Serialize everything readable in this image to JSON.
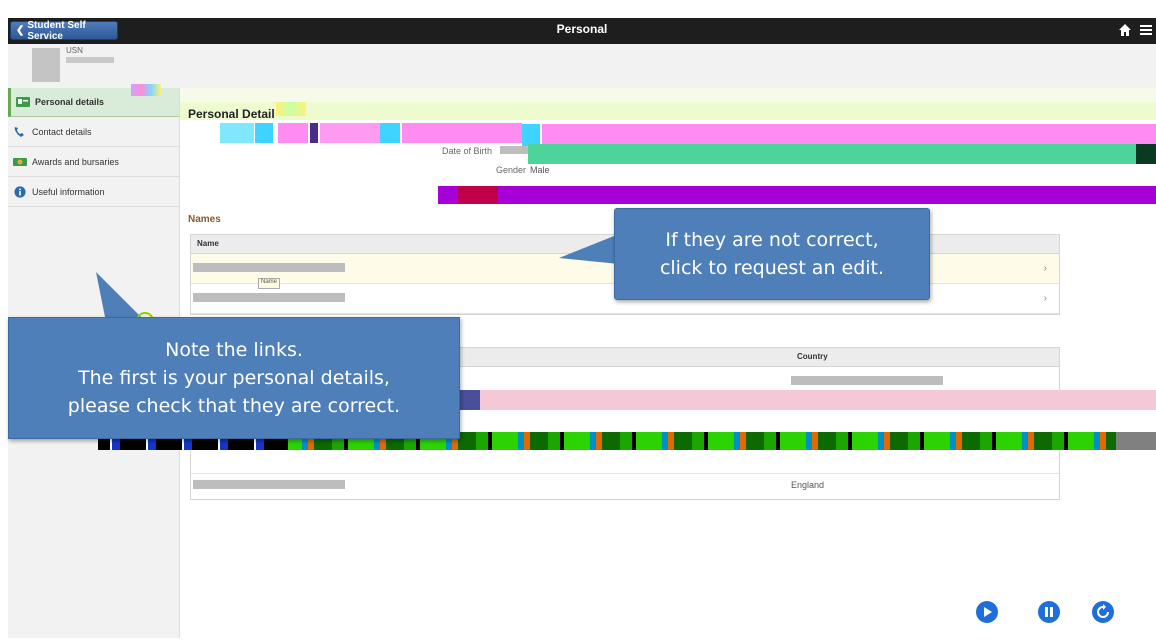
{
  "topbar": {
    "back_label": "Student Self Service",
    "title": "Personal"
  },
  "header": {
    "usn_label": "USN"
  },
  "sidebar": {
    "items": [
      {
        "label": "Personal details",
        "icon": "id-card-icon"
      },
      {
        "label": "Contact details",
        "icon": "phone-icon"
      },
      {
        "label": "Awards and bursaries",
        "icon": "award-icon"
      },
      {
        "label": "Useful information",
        "icon": "info-icon"
      }
    ]
  },
  "content": {
    "section_title": "Personal Detail",
    "dob_label": "Date of Birth",
    "gender_label": "Gender",
    "gender_value": "Male",
    "names_title": "Names",
    "names_col": "Name",
    "tooltip_text": "Name",
    "address_col_country": "Country",
    "address_country_value": "England"
  },
  "callouts": {
    "edit": {
      "line1": "If they are not correct,",
      "line2": "click to request an edit."
    },
    "links": {
      "line1": "Note the links.",
      "line2": "The first is your personal details,",
      "line3": "please check that they are correct."
    }
  },
  "player": {
    "controls": [
      "play-icon",
      "pause-icon",
      "replay-icon"
    ],
    "color": "#1e6fd9"
  },
  "colors": {
    "topbar": "#1e1e1e",
    "accent_blue": "#2d5895",
    "callout_blue": "#4f7fb8",
    "active_green": "#d9ebd9"
  }
}
